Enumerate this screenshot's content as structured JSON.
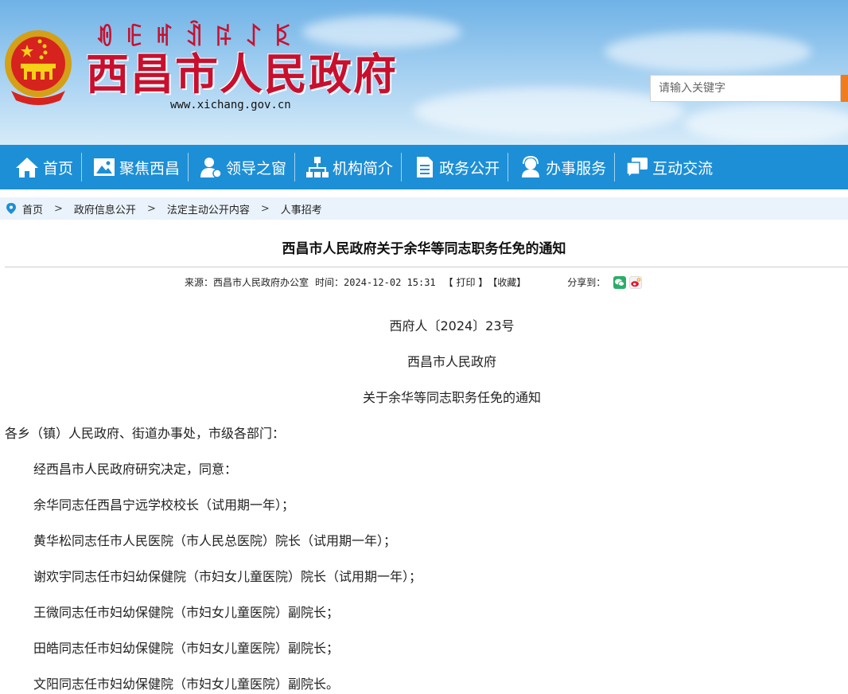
{
  "header": {
    "yi_script": "ꀑꍠꎭꀉꌬꋍꌅ",
    "site_title": "西昌市人民政府",
    "site_url": "www.xichang.gov.cn",
    "search_placeholder": "请输入关键字",
    "emblem_icon": "national-emblem-icon"
  },
  "nav": {
    "items": [
      {
        "label": "首页",
        "icon": "home-icon"
      },
      {
        "label": "聚焦西昌",
        "icon": "picture-icon"
      },
      {
        "label": "领导之窗",
        "icon": "leader-icon"
      },
      {
        "label": "机构简介",
        "icon": "org-chart-icon"
      },
      {
        "label": "政务公开",
        "icon": "document-icon"
      },
      {
        "label": "办事服务",
        "icon": "service-icon"
      },
      {
        "label": "互动交流",
        "icon": "chat-icon"
      }
    ]
  },
  "breadcrumb": {
    "items": [
      "首页",
      "政府信息公开",
      "法定主动公开内容",
      "人事招考"
    ],
    "separator": ">"
  },
  "article": {
    "title": "西昌市人民政府关于余华等同志职务任免的通知",
    "source_label": "来源：",
    "source": "西昌市人民政府办公室",
    "time_label": "时间：",
    "time": "2024-12-02 15:31",
    "print": "【 打印 】",
    "collect": "【收藏】",
    "share_label": "分享到：",
    "doc_number": "西府人〔2024〕23号",
    "issuer": "西昌市人民政府",
    "subtitle": "关于余华等同志职务任免的通知",
    "salutation": "各乡（镇）人民政府、街道办事处，市级各部门：",
    "paragraphs": [
      "经西昌市人民政府研究决定，同意：",
      "余华同志任西昌宁远学校校长（试用期一年）；",
      "黄华松同志任市人民医院（市人民总医院）院长（试用期一年）；",
      "谢欢宇同志任市妇幼保健院（市妇女儿童医院）院长（试用期一年）；",
      "王微同志任市妇幼保健院（市妇女儿童医院）副院长；",
      "田皓同志任市妇幼保健院（市妇女儿童医院）副院长；",
      "文阳同志任市妇幼保健院（市妇女儿童医院）副院长。"
    ]
  },
  "colors": {
    "nav_bg": "#1d8fd6",
    "title_red": "#c8102e",
    "search_button": "#f07c1e",
    "breadcrumb_bg": "#eaf3fb"
  }
}
